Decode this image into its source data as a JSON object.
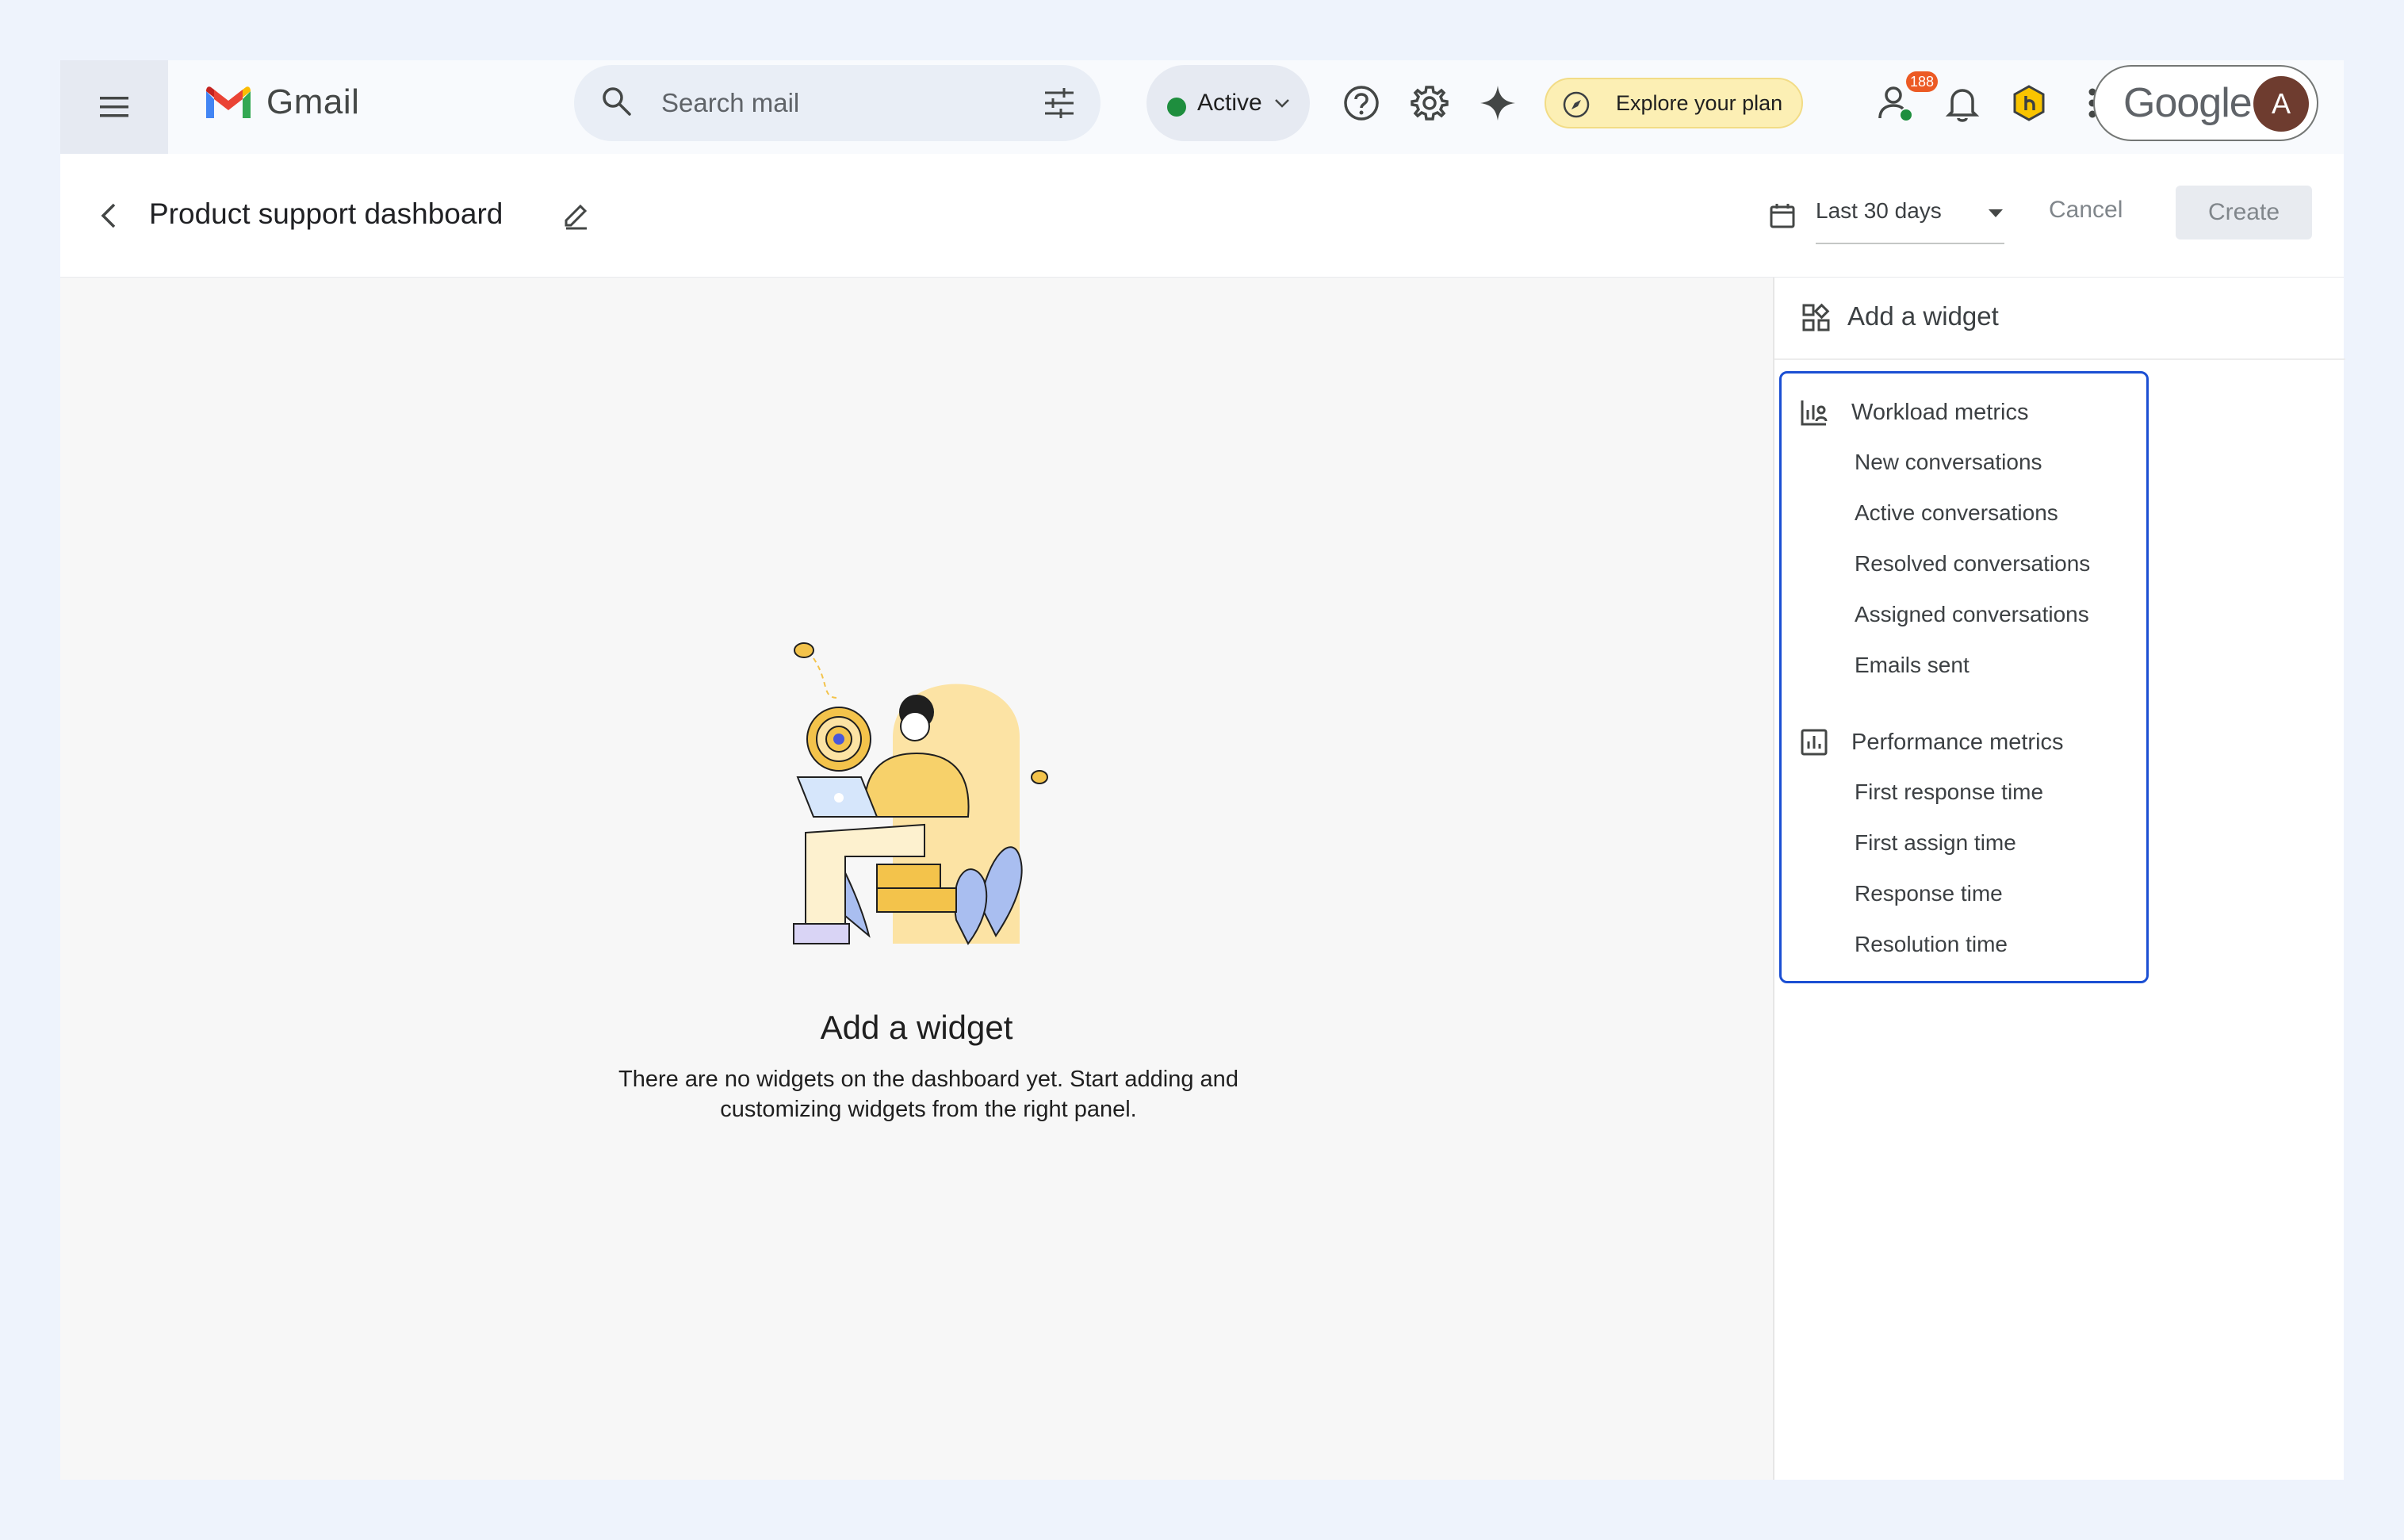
{
  "topbar": {
    "app_name": "Gmail",
    "search": {
      "placeholder": "Search mail"
    },
    "status": {
      "label": "Active",
      "color": "#1e8e3e"
    },
    "plan_label": "Explore your plan",
    "notification_count": "188",
    "account": {
      "brand": "Google",
      "avatar_letter": "A"
    }
  },
  "header": {
    "title": "Product support dashboard",
    "date_range": "Last 30 days",
    "cancel_label": "Cancel",
    "create_label": "Create"
  },
  "empty_state": {
    "title": "Add a widget",
    "description": "There are no widgets on the dashboard yet. Start adding and customizing widgets from the right panel."
  },
  "panel": {
    "title": "Add a widget",
    "groups": [
      {
        "title": "Workload metrics",
        "items": [
          "New conversations",
          "Active conversations",
          "Resolved conversations",
          "Assigned conversations",
          "Emails sent"
        ]
      },
      {
        "title": "Performance metrics",
        "items": [
          "First response time",
          "First assign time",
          "Response time",
          "Resolution time"
        ]
      }
    ]
  },
  "colors": {
    "accent_border": "#1b4fd3",
    "page_bg": "#eef3fc",
    "plan_pill": "#fcefb4",
    "badge": "#ec5a24"
  }
}
